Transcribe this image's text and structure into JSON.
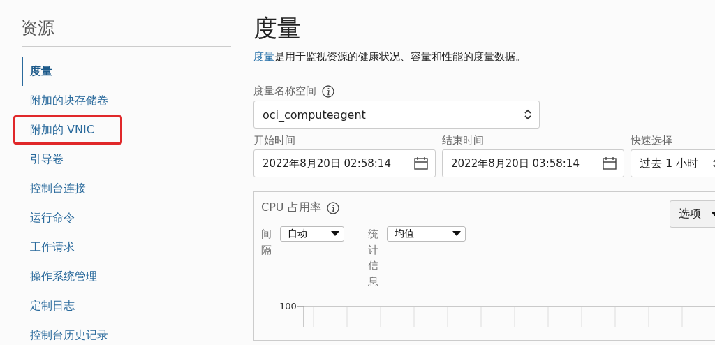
{
  "sidebar": {
    "title": "资源",
    "items": [
      {
        "label": "度量",
        "selected": true,
        "highlighted": false
      },
      {
        "label": "附加的块存储卷",
        "selected": false,
        "highlighted": false
      },
      {
        "label": "附加的 VNIC",
        "selected": false,
        "highlighted": true
      },
      {
        "label": "引导卷",
        "selected": false,
        "highlighted": false
      },
      {
        "label": "控制台连接",
        "selected": false,
        "highlighted": false
      },
      {
        "label": "运行命令",
        "selected": false,
        "highlighted": false
      },
      {
        "label": "工作请求",
        "selected": false,
        "highlighted": false
      },
      {
        "label": "操作系统管理",
        "selected": false,
        "highlighted": false
      },
      {
        "label": "定制日志",
        "selected": false,
        "highlighted": false
      },
      {
        "label": "控制台历史记录",
        "selected": false,
        "highlighted": false
      }
    ]
  },
  "main": {
    "title": "度量",
    "description_link": "度量",
    "description": "是用于监视资源的健康状况、容量和性能的度量数据。",
    "namespace": {
      "label": "度量名称空间",
      "value": "oci_computeagent"
    },
    "start": {
      "label": "开始时间",
      "value": "2022年8月20日 02:58:14"
    },
    "end": {
      "label": "结束时间",
      "value": "2022年8月20日 03:58:14"
    },
    "quick": {
      "label": "快速选择",
      "value": "过去 1 小时"
    },
    "chart_card": {
      "title": "CPU 占用率",
      "options_button": "选项",
      "interval": {
        "label": "间隔",
        "value": "自动"
      },
      "statistic": {
        "label": "统计信息",
        "value": "均值"
      },
      "y_tick": "100"
    }
  }
}
